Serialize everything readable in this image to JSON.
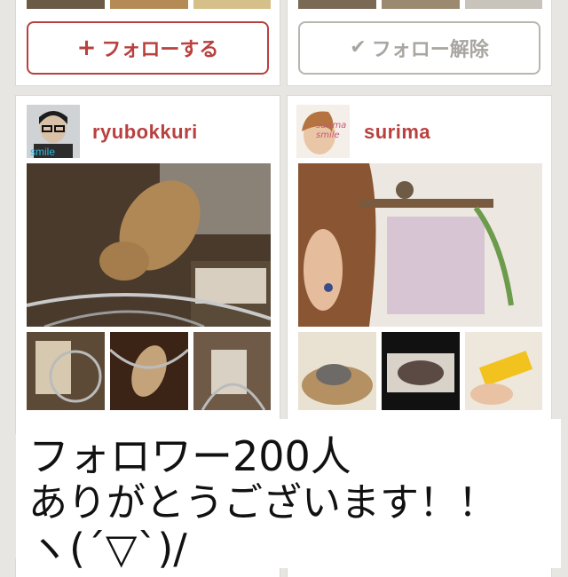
{
  "buttons": {
    "follow_label": "フォローする",
    "follow_icon": "+",
    "unfollow_label": "フォロー解除",
    "unfollow_icon": "✔"
  },
  "users": [
    {
      "username": "ryubokkuri",
      "avatar_caption": "smile"
    },
    {
      "username": "surima",
      "avatar_caption": "surima smile"
    }
  ],
  "overlay": {
    "line1": "フォロワー200人",
    "line2": "ありがとうございます！！",
    "line3": "ヽ(´▽`)/"
  },
  "colors": {
    "accent": "#b8413f",
    "muted": "#a9a6a1",
    "background": "#e8e6e2"
  }
}
